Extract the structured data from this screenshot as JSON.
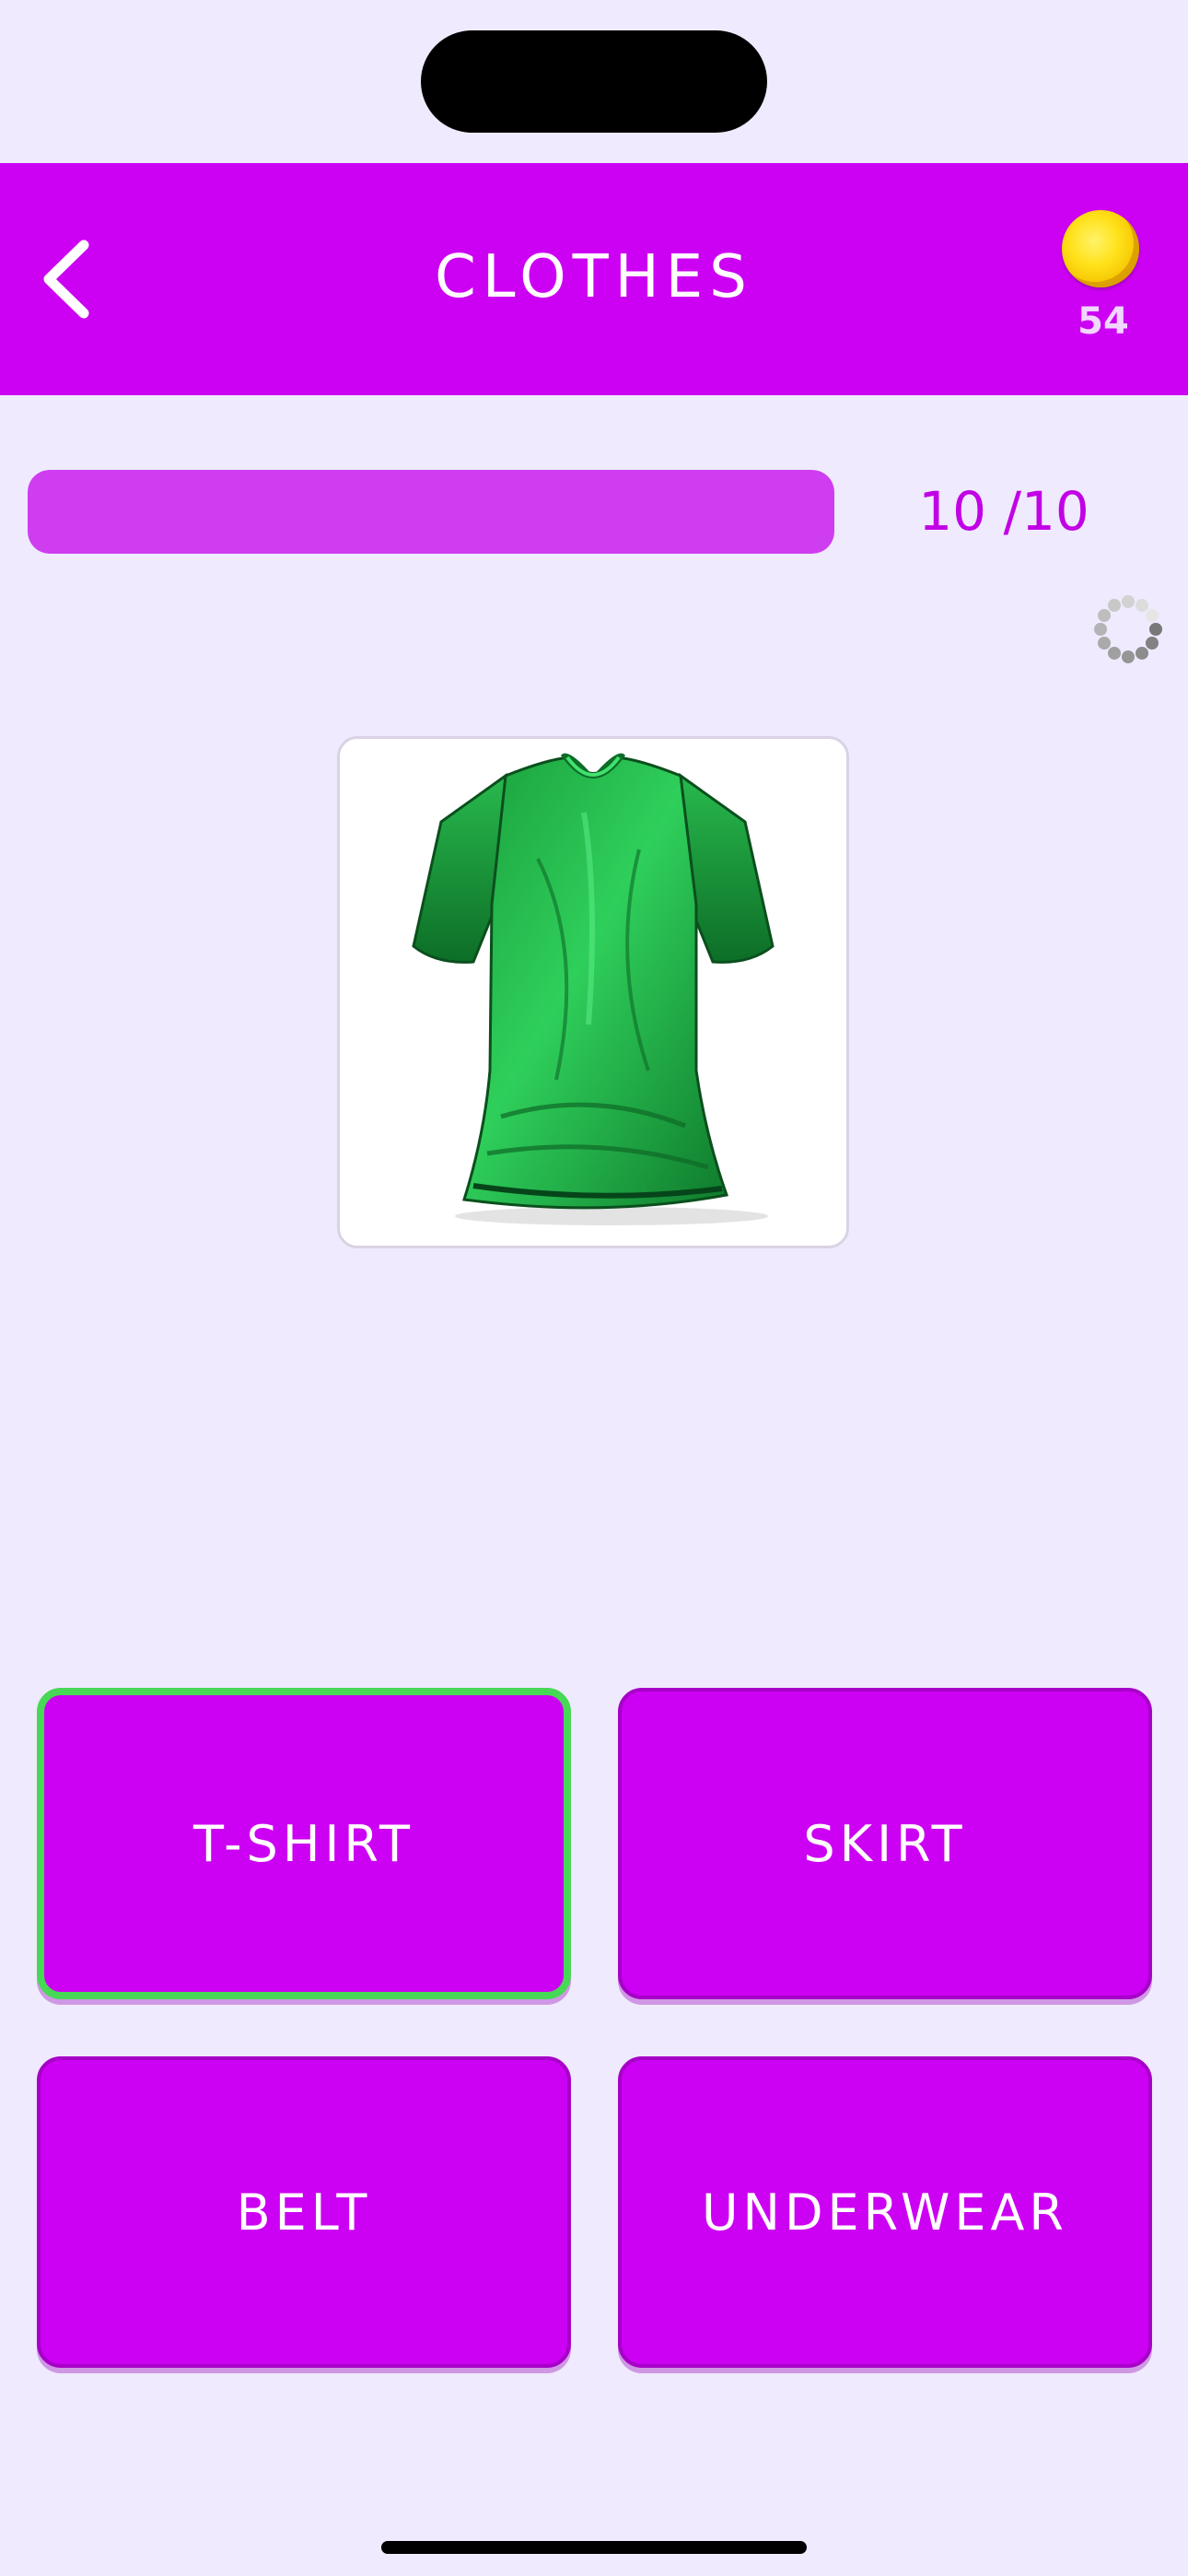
{
  "header": {
    "title": "CLOTHES",
    "coins": "54",
    "accent_color": "#cc00f2"
  },
  "progress": {
    "label": "10 /10",
    "fraction": 1.0
  },
  "question": {
    "image": "green-tshirt-illustration"
  },
  "answers": [
    {
      "label": "T-SHIRT",
      "state": "correct"
    },
    {
      "label": "SKIRT",
      "state": "default"
    },
    {
      "label": "BELT",
      "state": "default"
    },
    {
      "label": "UNDERWEAR",
      "state": "default"
    }
  ],
  "icons": {
    "back": "chevron-left-icon",
    "coin": "coin-icon",
    "loading": "spinner-icon"
  },
  "colors": {
    "correct_border": "#47d856",
    "background": "#efeafd"
  }
}
